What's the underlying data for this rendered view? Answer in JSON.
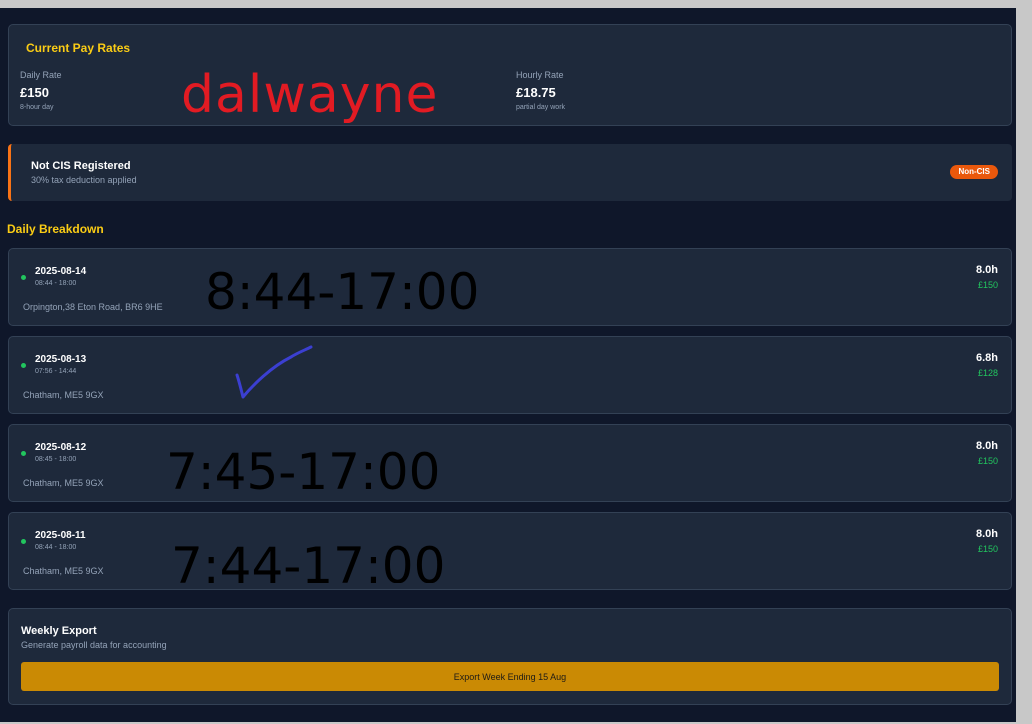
{
  "pay_rates": {
    "title": "Current Pay Rates",
    "daily_label": "Daily Rate",
    "daily_value": "£150",
    "daily_sub": "8-hour day",
    "hourly_label": "Hourly Rate",
    "hourly_value": "£18.75",
    "hourly_sub": "partial day work",
    "annotation": "dalwayne"
  },
  "cis": {
    "title": "Not CIS Registered",
    "subtitle": "30% tax deduction applied",
    "badge": "Non-CIS"
  },
  "breakdown": {
    "title": "Daily Breakdown",
    "days": [
      {
        "date": "2025-08-14",
        "times": "08:44 - 18:00",
        "location": "Orpington,38 Eton Road, BR6 9HE",
        "hours": "8.0h",
        "pay": "£150",
        "annotation": "8:44-17:00"
      },
      {
        "date": "2025-08-13",
        "times": "07:56 - 14:44",
        "location": "Chatham, ME5 9GX",
        "hours": "6.8h",
        "pay": "£128",
        "annotation": ""
      },
      {
        "date": "2025-08-12",
        "times": "08:45 - 18:00",
        "location": "Chatham, ME5 9GX",
        "hours": "8.0h",
        "pay": "£150",
        "annotation": "7:45-17:00"
      },
      {
        "date": "2025-08-11",
        "times": "08:44 - 18:00",
        "location": "Chatham, ME5 9GX",
        "hours": "8.0h",
        "pay": "£150",
        "annotation": "7:44-17:00"
      }
    ]
  },
  "export": {
    "title": "Weekly Export",
    "subtitle": "Generate payroll data for accounting",
    "button_label": "Export Week Ending 15 Aug"
  },
  "colors": {
    "background": "#0f172a",
    "card": "#1e293b",
    "accent_yellow": "#facc15",
    "status_green": "#22c55e",
    "badge_orange": "#ea580c",
    "button_gold": "#ca8a04",
    "handwriting_red": "#e21b23",
    "checkmark_blue": "#3b3fd1"
  },
  "icons": {
    "status_dot": "green-dot-icon",
    "checkmark": "checkmark-annotation"
  }
}
